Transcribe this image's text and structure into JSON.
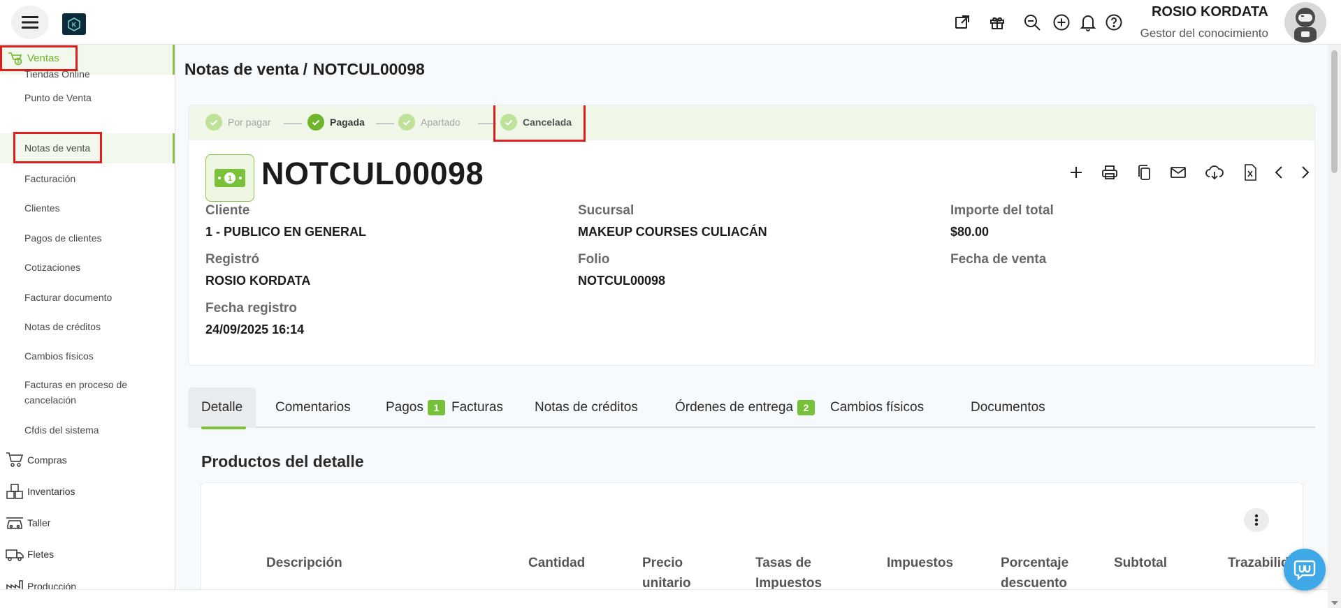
{
  "header": {
    "user_name": "ROSIO KORDATA",
    "user_role": "Gestor del conocimiento"
  },
  "sidebar": {
    "active_section": "Ventas",
    "ventas_items": [
      "Tiendas Online",
      "Punto de Venta",
      "Notas de venta",
      "Facturación",
      "Clientes",
      "Pagos de clientes",
      "Cotizaciones",
      "Facturar documento",
      "Notas de créditos",
      "Cambios físicos",
      "Facturas en proceso de cancelación",
      "Cfdis del sistema"
    ],
    "sections": [
      "Compras",
      "Inventarios",
      "Taller",
      "Fletes",
      "Producción"
    ]
  },
  "breadcrumb": {
    "parent": "Notas de venta",
    "separator": "/",
    "current": "NOTCUL00098"
  },
  "stepper": [
    {
      "label": "Por pagar",
      "state": "done-light"
    },
    {
      "label": "Pagada",
      "state": "done"
    },
    {
      "label": "Apartado",
      "state": "done-light"
    },
    {
      "label": "Cancelada",
      "state": "current"
    }
  ],
  "document": {
    "number": "NOTCUL00098",
    "fields": {
      "cliente": {
        "label": "Cliente",
        "value": "1 - PUBLICO EN GENERAL"
      },
      "sucursal": {
        "label": "Sucursal",
        "value": "MAKEUP COURSES CULIACÁN"
      },
      "importe": {
        "label": "Importe del total",
        "value": "$80.00"
      },
      "registro": {
        "label": "Registró",
        "value": "ROSIO KORDATA"
      },
      "folio": {
        "label": "Folio",
        "value": "NOTCUL00098"
      },
      "fecha_venta": {
        "label": "Fecha de venta",
        "value": ""
      },
      "fecha_registro": {
        "label": "Fecha registro",
        "value": "24/09/2025 16:14"
      }
    }
  },
  "tabs": [
    {
      "label": "Detalle",
      "badge": ""
    },
    {
      "label": "Comentarios",
      "badge": ""
    },
    {
      "label": "Pagos",
      "badge": "1"
    },
    {
      "label": "Facturas",
      "badge": ""
    },
    {
      "label": "Notas de créditos",
      "badge": ""
    },
    {
      "label": "Órdenes de entrega",
      "badge": "2"
    },
    {
      "label": "Cambios físicos",
      "badge": ""
    },
    {
      "label": "Documentos",
      "badge": ""
    }
  ],
  "detail": {
    "section_title": "Productos del detalle",
    "columns": [
      [
        "Descripción"
      ],
      [
        "Cantidad"
      ],
      [
        "Precio",
        "unitario"
      ],
      [
        "Tasas de",
        "Impuestos"
      ],
      [
        "Impuestos"
      ],
      [
        "Porcentaje",
        "descuento"
      ],
      [
        "Subtotal"
      ],
      [
        "Trazabilidad"
      ]
    ]
  },
  "colors": {
    "accent_green": "#7cc13a",
    "highlight_red": "#e01e1e",
    "chat_blue": "#3fa8e6"
  }
}
